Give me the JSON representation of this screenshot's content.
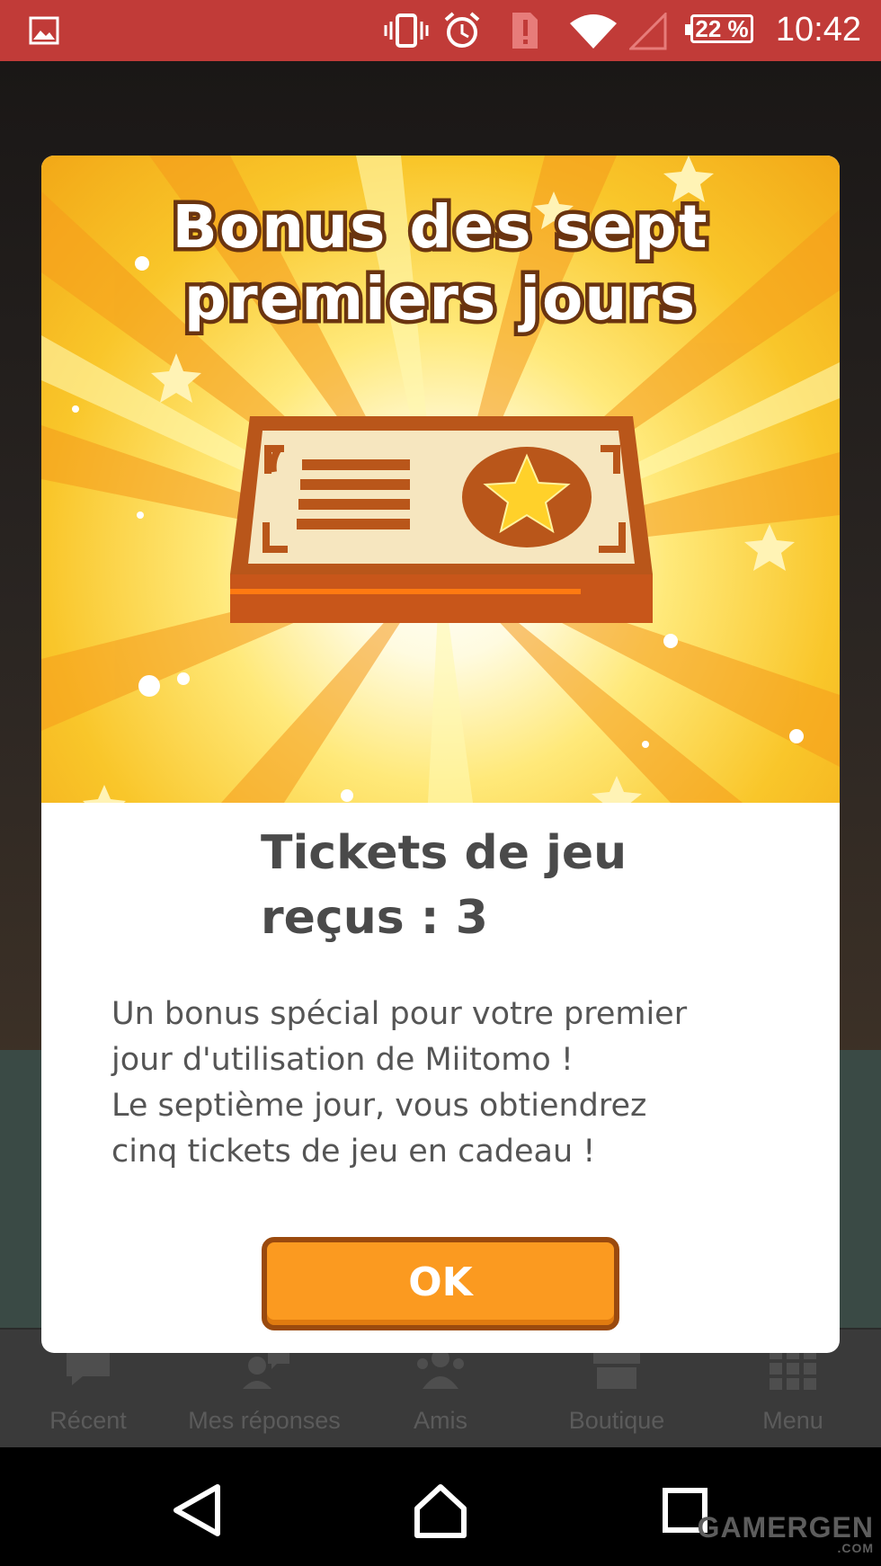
{
  "status_bar": {
    "time": "10:42",
    "battery": "22 %",
    "icons": [
      "gallery-icon",
      "vibrate-icon",
      "alarm-icon",
      "alert-icon",
      "wifi-icon",
      "signal-icon",
      "battery-icon"
    ],
    "color": "#c13b38"
  },
  "modal": {
    "title_line1": "Bonus des sept",
    "title_line2": "premiers jours",
    "reward_title_line1": "Tickets de jeu",
    "reward_title_line2": "reçus : 3",
    "description": [
      "Un bonus spécial pour votre premier",
      "jour d'utilisation de Miitomo !",
      "Le septième jour, vous obtiendrez",
      "cinq tickets de jeu en cadeau !"
    ],
    "ok_label": "OK",
    "ticket_icon": "game-ticket-icon",
    "accent_color": "#fb9a20"
  },
  "bottom_nav": {
    "items": [
      {
        "label": "Récent",
        "icon": "chat-bubble-icon"
      },
      {
        "label": "Mes réponses",
        "icon": "my-answers-icon"
      },
      {
        "label": "Amis",
        "icon": "friends-icon"
      },
      {
        "label": "Boutique",
        "icon": "shop-icon"
      },
      {
        "label": "Menu",
        "icon": "grid-menu-icon"
      }
    ]
  },
  "watermark": {
    "text": "GAMERGEN",
    "sub": ".COM"
  }
}
